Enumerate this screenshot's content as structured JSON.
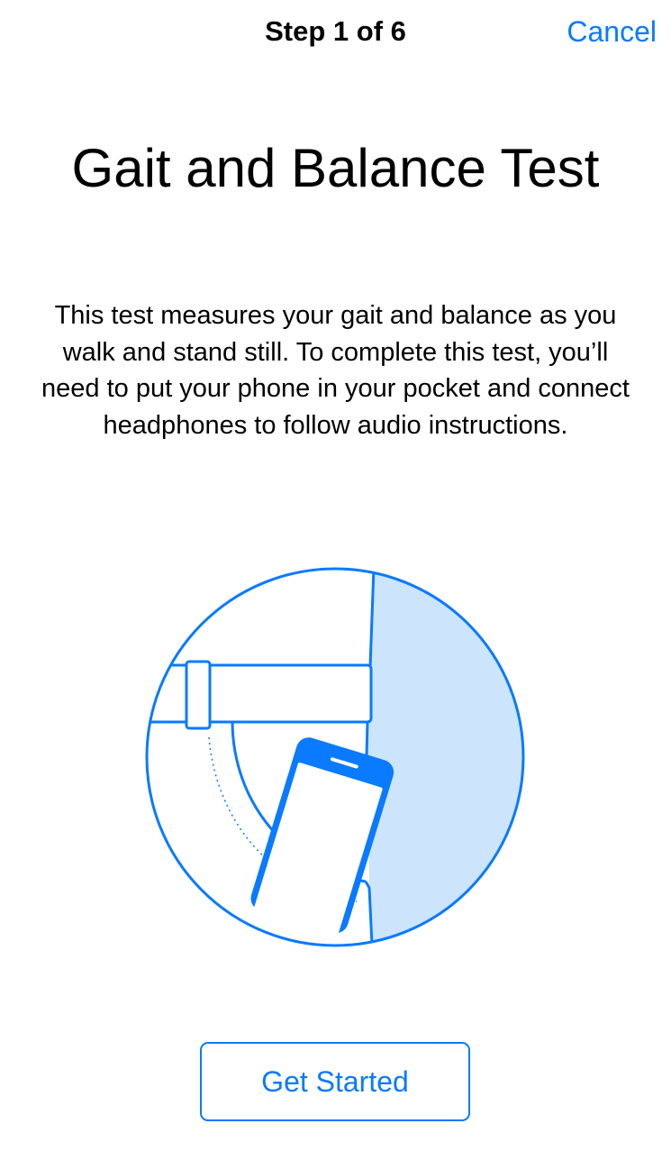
{
  "nav": {
    "title": "Step 1 of 6",
    "cancel_label": "Cancel"
  },
  "main": {
    "title": "Gait and Balance Test",
    "description": "This test measures your gait and balance as you walk and stand still. To complete this test, you’ll need to put your phone in your pocket and connect headphones to follow audio instructions.",
    "illustration_icon": "phone-in-pocket-icon"
  },
  "footer": {
    "get_started_label": "Get Started"
  },
  "colors": {
    "accent": "#0a7aff",
    "illustration_fill": "#cce5fd"
  }
}
